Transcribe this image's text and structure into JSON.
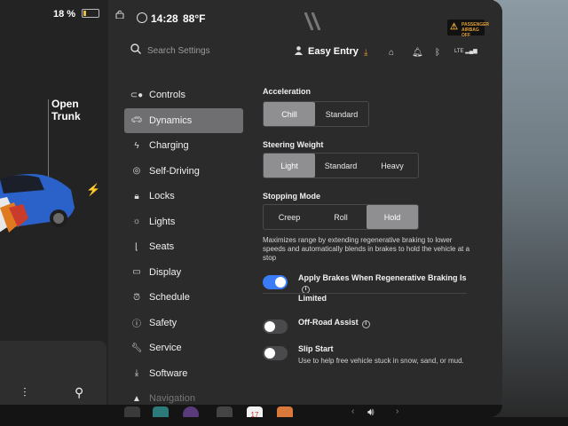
{
  "status": {
    "battery": "18 %",
    "time": "14:28",
    "temperature": "88°F"
  },
  "airbag": {
    "line1": "PASSENGER",
    "line2": "AIRBAG OFF"
  },
  "car_panel": {
    "trunk_label_1": "Open",
    "trunk_label_2": "Trunk"
  },
  "search": {
    "placeholder": "Search Settings"
  },
  "profile": {
    "name": "Easy Entry"
  },
  "header_icons": [
    "download-icon",
    "garage-icon",
    "bell-icon",
    "bluetooth-icon",
    "lte-signal-icon"
  ],
  "lte": "LTE",
  "nav": [
    {
      "label": "Controls",
      "icon": "toggle-icon"
    },
    {
      "label": "Dynamics",
      "icon": "car-icon"
    },
    {
      "label": "Charging",
      "icon": "bolt-icon"
    },
    {
      "label": "Self-Driving",
      "icon": "steering-wheel-icon"
    },
    {
      "label": "Locks",
      "icon": "lock-icon"
    },
    {
      "label": "Lights",
      "icon": "light-icon"
    },
    {
      "label": "Seats",
      "icon": "seat-icon"
    },
    {
      "label": "Display",
      "icon": "display-icon"
    },
    {
      "label": "Schedule",
      "icon": "clock-icon"
    },
    {
      "label": "Safety",
      "icon": "warning-icon"
    },
    {
      "label": "Service",
      "icon": "wrench-icon"
    },
    {
      "label": "Software",
      "icon": "download-icon"
    },
    {
      "label": "Navigation",
      "icon": "navigation-icon"
    }
  ],
  "dynamics": {
    "acceleration": {
      "label": "Acceleration",
      "options": [
        "Chill",
        "Standard"
      ],
      "selected": "Chill"
    },
    "steering": {
      "label": "Steering Weight",
      "options": [
        "Light",
        "Standard",
        "Heavy"
      ],
      "selected": "Light"
    },
    "stopping": {
      "label": "Stopping Mode",
      "options": [
        "Creep",
        "Roll",
        "Hold"
      ],
      "selected": "Hold"
    },
    "stopping_desc": "Maximizes range by extending regenerative braking to lower speeds and automatically blends in brakes to hold the vehicle at a stop",
    "apply_brakes": {
      "label_1": "Apply Brakes When Regenerative Braking Is",
      "label_2": "Limited",
      "on": true
    },
    "offroad": {
      "label": "Off-Road Assist",
      "on": false
    },
    "slip": {
      "label": "Slip Start",
      "sub": "Use to help free vehicle stuck in snow, sand, or mud.",
      "on": false
    }
  },
  "dock": {
    "calendar_day": "17"
  },
  "colors": {
    "toggle_on": "#3a7bf6",
    "selected_segment": "#8f8f92",
    "active_nav": "#6f6f71",
    "warning_amber": "#e0a030"
  }
}
